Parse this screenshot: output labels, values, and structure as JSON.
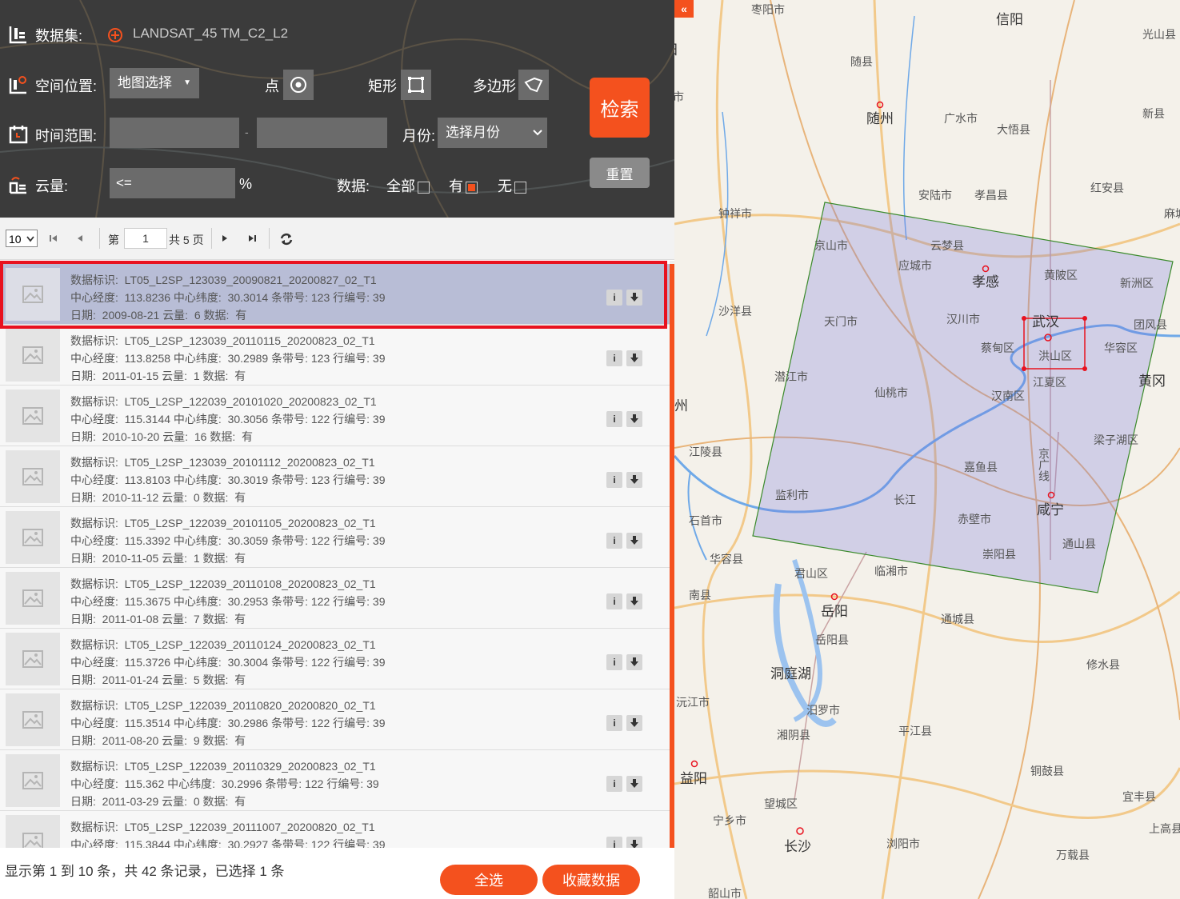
{
  "query": {
    "dataset_label": "数据集:",
    "dataset_value": "LANDSAT_45 TM_C2_L2",
    "location_label": "空间位置:",
    "location_select": "地图选择",
    "point_label": "点",
    "rect_label": "矩形",
    "polygon_label": "多边形",
    "time_label": "时间范围:",
    "time_sep": "-",
    "month_label": "月份:",
    "month_select": "选择月份",
    "cloud_label": "云量:",
    "cloud_op": "<=",
    "cloud_unit": "%",
    "data_label": "数据:",
    "data_all": "全部",
    "data_yes": "有",
    "data_no": "无",
    "search_button": "检索",
    "reset_button": "重置"
  },
  "pager": {
    "page_size": "10",
    "page_prefix": "第",
    "page_current": "1",
    "page_total": "共 5 页"
  },
  "field_labels": {
    "id": "数据标识:",
    "lon": "中心经度:",
    "lat": "中心纬度:",
    "path": "条带号:",
    "row": "行编号:",
    "date": "日期:",
    "cloud": "云量:",
    "data": "数据:"
  },
  "records": [
    {
      "id": "LT05_L2SP_123039_20090821_20200827_02_T1",
      "lon": "113.8236",
      "lat": "30.3014",
      "path": "123",
      "row": "39",
      "date": "2009-08-21",
      "cloud": "6",
      "data": "有",
      "selected": true
    },
    {
      "id": "LT05_L2SP_123039_20110115_20200823_02_T1",
      "lon": "113.8258",
      "lat": "30.2989",
      "path": "123",
      "row": "39",
      "date": "2011-01-15",
      "cloud": "1",
      "data": "有",
      "selected": false
    },
    {
      "id": "LT05_L2SP_122039_20101020_20200823_02_T1",
      "lon": "115.3144",
      "lat": "30.3056",
      "path": "122",
      "row": "39",
      "date": "2010-10-20",
      "cloud": "16",
      "data": "有",
      "selected": false
    },
    {
      "id": "LT05_L2SP_123039_20101112_20200823_02_T1",
      "lon": "113.8103",
      "lat": "30.3019",
      "path": "123",
      "row": "39",
      "date": "2010-11-12",
      "cloud": "0",
      "data": "有",
      "selected": false
    },
    {
      "id": "LT05_L2SP_122039_20101105_20200823_02_T1",
      "lon": "115.3392",
      "lat": "30.3059",
      "path": "122",
      "row": "39",
      "date": "2010-11-05",
      "cloud": "1",
      "data": "有",
      "selected": false
    },
    {
      "id": "LT05_L2SP_122039_20110108_20200823_02_T1",
      "lon": "115.3675",
      "lat": "30.2953",
      "path": "122",
      "row": "39",
      "date": "2011-01-08",
      "cloud": "7",
      "data": "有",
      "selected": false
    },
    {
      "id": "LT05_L2SP_122039_20110124_20200823_02_T1",
      "lon": "115.3726",
      "lat": "30.3004",
      "path": "122",
      "row": "39",
      "date": "2011-01-24",
      "cloud": "5",
      "data": "有",
      "selected": false
    },
    {
      "id": "LT05_L2SP_122039_20110820_20200820_02_T1",
      "lon": "115.3514",
      "lat": "30.2986",
      "path": "122",
      "row": "39",
      "date": "2011-08-20",
      "cloud": "9",
      "data": "有",
      "selected": false
    },
    {
      "id": "LT05_L2SP_122039_20110329_20200823_02_T1",
      "lon": "115.362",
      "lat": "30.2996",
      "path": "122",
      "row": "39",
      "date": "2011-03-29",
      "cloud": "0",
      "data": "有",
      "selected": false
    },
    {
      "id": "LT05_L2SP_122039_20111007_20200820_02_T1",
      "lon": "115.3844",
      "lat": "30.2927",
      "path": "122",
      "row": "39",
      "date": "",
      "cloud": "",
      "data": "",
      "selected": false
    }
  ],
  "footer": {
    "summary": "显示第 1 到 10 条，共 42 条记录，已选择 1 条",
    "select_all": "全选",
    "collect": "收藏数据"
  },
  "map": {
    "collapse": "«",
    "labels": {
      "zaoyang": "枣阳市",
      "xinyang": "信阳",
      "guangshan": "光山县",
      "suixian": "随县",
      "suizhou": "随州",
      "guangshui": "广水市",
      "dawu": "大悟县",
      "xinxian": "新县",
      "zhongxiang": "钟祥市",
      "anlu": "安陆市",
      "xiaochang": "孝昌县",
      "hongan": "红安县",
      "macheng": "麻城",
      "jingshan": "京山市",
      "yunmeng": "云梦县",
      "yingcheng": "应城市",
      "xiaogan": "孝感",
      "huangpi": "黄陂区",
      "xinzhou": "新洲区",
      "shayang": "沙洋县",
      "tianmen": "天门市",
      "hanchuan": "汉川市",
      "wuhan": "武汉",
      "caidian": "蔡甸区",
      "hongshan": "洪山区",
      "tuanfeng": "团风县",
      "huarong": "华容区",
      "huanggang": "黄冈",
      "qianjiang": "潜江市",
      "xiantao": "仙桃市",
      "jiangxia": "江夏区",
      "hannan": "汉南区",
      "liangzihu": "梁子湖区",
      "jiangling": "江陵县",
      "jiayu": "嘉鱼县",
      "jingguang": "京广线",
      "jianli": "监利市",
      "changjiang": "长江",
      "chibi": "赤壁市",
      "xianning": "咸宁",
      "shishou": "石首市",
      "tongshan": "通山县",
      "chongyang": "崇阳县",
      "huarongxian": "华容县",
      "junshan": "君山区",
      "linxiang": "临湘市",
      "nanxian": "南县",
      "yueyang": "岳阳",
      "tongcheng": "通城县",
      "yueyangxian": "岳阳县",
      "dongtinghu": "洞庭湖",
      "xiushui": "修水县",
      "yuanjiang": "沅江市",
      "miluo": "汨罗市",
      "pingjiang": "平江县",
      "xiangyin": "湘阴县",
      "yiyang": "益阳",
      "tonggu": "铜鼓县",
      "wangcheng": "望城区",
      "yifeng": "宜丰县",
      "ningxiang": "宁乡市",
      "changsha": "长沙",
      "shanggao": "上高县",
      "liuyang": "浏阳市",
      "wanzai": "万载县",
      "shaoshan": "韶山市",
      "xiangyang": "襄阳",
      "yicheng": "宜城市",
      "zhijiang": "州"
    }
  }
}
